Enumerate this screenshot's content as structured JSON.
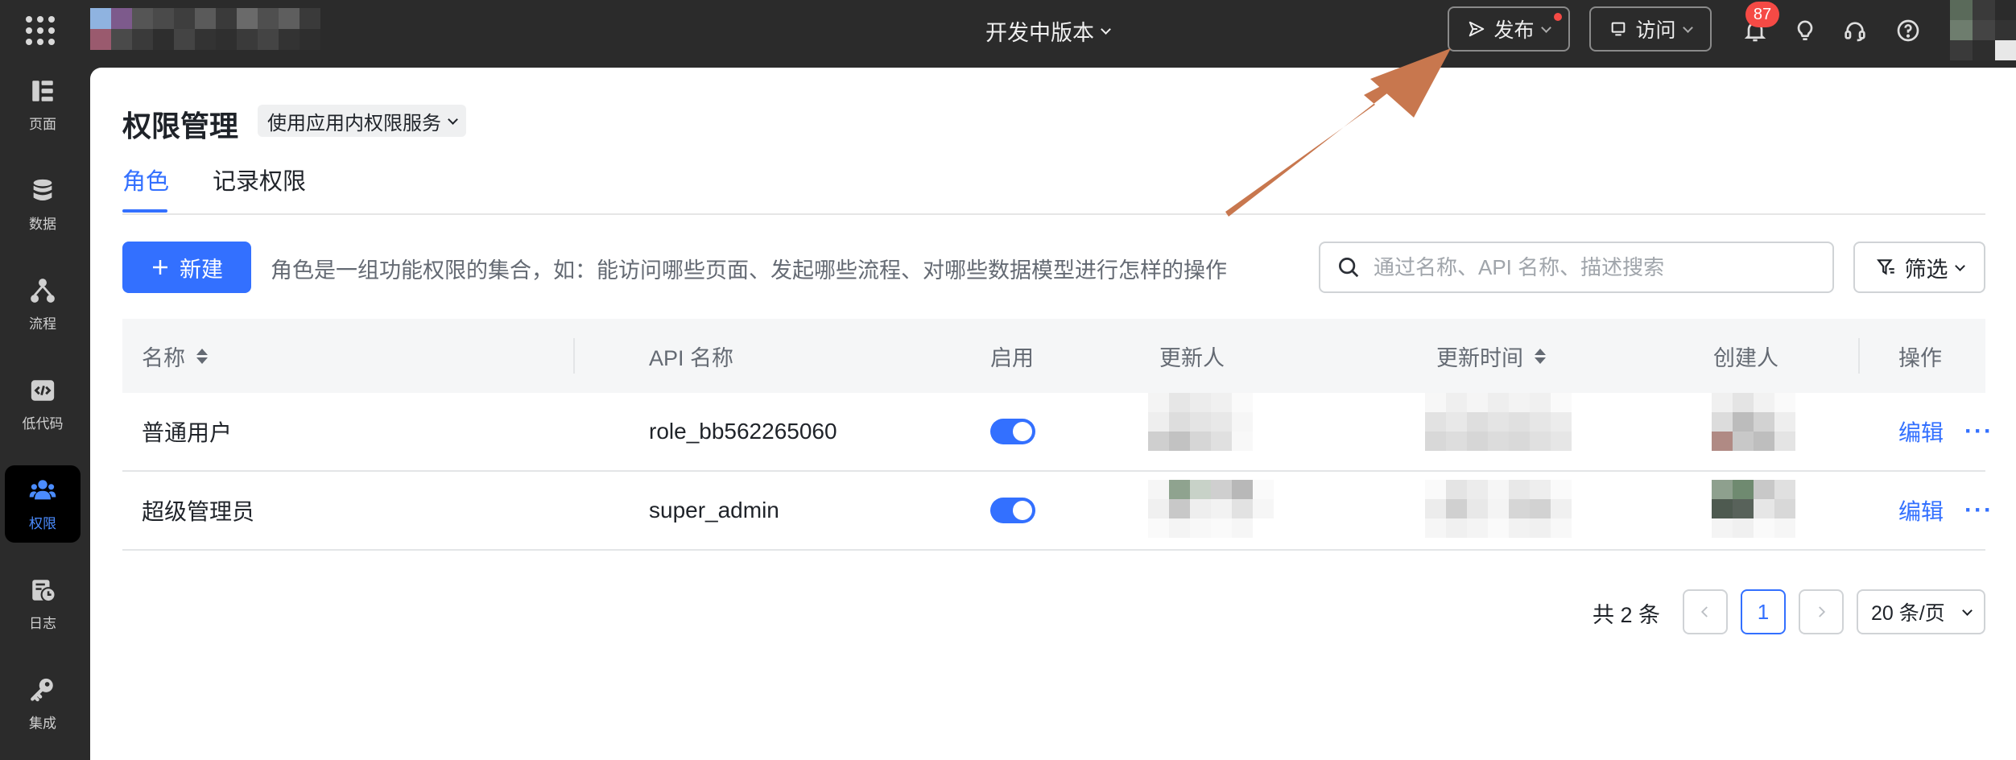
{
  "topbar": {
    "version_label": "开发中版本",
    "publish_label": "发布",
    "visit_label": "访问",
    "notification_count": "87"
  },
  "sidebar": {
    "items": [
      {
        "label": "页面",
        "icon": "page-icon"
      },
      {
        "label": "数据",
        "icon": "database-icon"
      },
      {
        "label": "流程",
        "icon": "flow-icon"
      },
      {
        "label": "低代码",
        "icon": "code-icon"
      },
      {
        "label": "权限",
        "icon": "people-icon",
        "active": true
      },
      {
        "label": "日志",
        "icon": "log-icon"
      },
      {
        "label": "集成",
        "icon": "key-icon"
      }
    ]
  },
  "page": {
    "title": "权限管理",
    "service_dropdown": "使用应用内权限服务"
  },
  "tabs": [
    {
      "label": "角色",
      "active": true
    },
    {
      "label": "记录权限",
      "active": false
    }
  ],
  "toolbar": {
    "new_label": "新建",
    "description": "角色是一组功能权限的集合，如：能访问哪些页面、发起哪些流程、对哪些数据模型进行怎样的操作",
    "search_placeholder": "通过名称、API 名称、描述搜索",
    "filter_label": "筛选"
  },
  "table": {
    "headers": {
      "name": "名称",
      "api_name": "API 名称",
      "enabled": "启用",
      "updater": "更新人",
      "update_time": "更新时间",
      "creator": "创建人",
      "actions": "操作"
    },
    "rows": [
      {
        "name": "普通用户",
        "api_name": "role_bb562265060",
        "enabled": true,
        "edit_label": "编辑",
        "more_label": "···"
      },
      {
        "name": "超级管理员",
        "api_name": "super_admin",
        "enabled": true,
        "edit_label": "编辑",
        "more_label": "···"
      }
    ]
  },
  "pagination": {
    "total_label": "共 2 条",
    "current_page": "1",
    "page_size_label": "20 条/页"
  },
  "colors": {
    "accent": "#3370ff",
    "topbar_bg": "#2b2b2b",
    "annotation_arrow": "#c8774e",
    "badge": "#f54a45"
  }
}
